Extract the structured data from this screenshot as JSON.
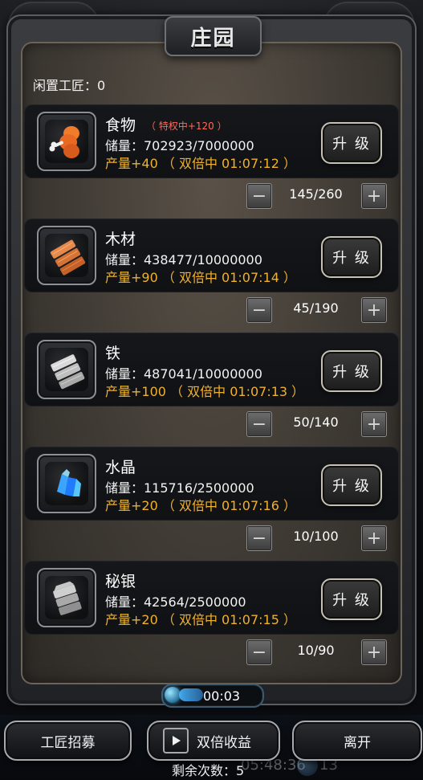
{
  "title": "庄园",
  "idle_workers": "闲置工匠：0",
  "resources": [
    {
      "name": "食物",
      "privilege": "（ 特权中+120 ）",
      "storage": "储量：702923/7000000",
      "production": "产量+40 （ 双倍中 01:07:12 ）",
      "upgrade_label": "升 级",
      "workers": "145/260",
      "icon": "food-icon"
    },
    {
      "name": "木材",
      "privilege": "",
      "storage": "储量：438477/10000000",
      "production": "产量+90 （ 双倍中 01:07:14 ）",
      "upgrade_label": "升 级",
      "workers": "45/190",
      "icon": "wood-icon"
    },
    {
      "name": "铁",
      "privilege": "",
      "storage": "储量：487041/10000000",
      "production": "产量+100 （ 双倍中 01:07:13 ）",
      "upgrade_label": "升 级",
      "workers": "50/140",
      "icon": "iron-icon"
    },
    {
      "name": "水晶",
      "privilege": "",
      "storage": "储量：115716/2500000",
      "production": "产量+20 （ 双倍中 01:07:16 ）",
      "upgrade_label": "升 级",
      "workers": "10/100",
      "icon": "crystal-icon"
    },
    {
      "name": "秘银",
      "privilege": "",
      "storage": "储量：42564/2500000",
      "production": "产量+20 （ 双倍中 01:07:15 ）",
      "upgrade_label": "升 级",
      "workers": "10/90",
      "icon": "mithril-icon"
    }
  ],
  "stepper": {
    "minus": "−",
    "plus": "+"
  },
  "timer": {
    "time": "00:03"
  },
  "bottom": {
    "recruit_label": "工匠招募",
    "double_label": "双倍收益",
    "leave_label": "离开",
    "remaining": "剩余次数：5"
  },
  "background": {
    "ghost_time": "05:48:36",
    "ghost_number": "13"
  },
  "colors": {
    "production": "#f1b12a",
    "privilege": "#ff6a5a",
    "panel": "#3f3a34",
    "row": "#15171a"
  }
}
